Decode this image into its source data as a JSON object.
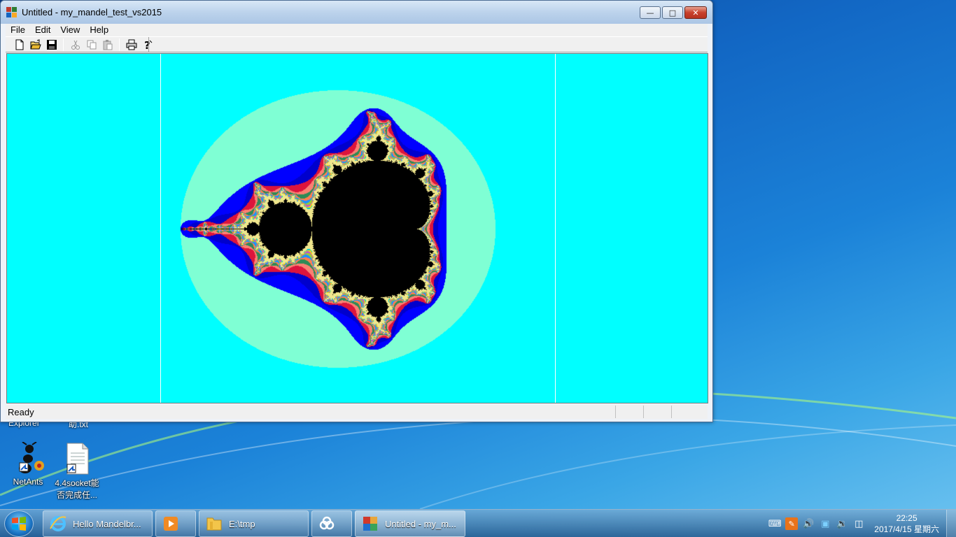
{
  "window": {
    "title": "Untitled - my_mandel_test_vs2015",
    "menu": [
      "File",
      "Edit",
      "View",
      "Help"
    ],
    "toolbar": [
      "new",
      "open",
      "save",
      "cut",
      "copy",
      "paste",
      "print",
      "help"
    ],
    "status": "Ready",
    "background_color": "#deb887"
  },
  "desktop": {
    "partial_labels": [
      "Explorer",
      "助.txt"
    ],
    "icons": [
      {
        "label": "NetAnts"
      },
      {
        "label_line1": "4.4socket能",
        "label_line2": "否完成任..."
      }
    ]
  },
  "taskbar": {
    "buttons": [
      {
        "label": "Hello Mandelbr..."
      },
      {
        "label": ""
      },
      {
        "label": "E:\\tmp"
      },
      {
        "label": ""
      },
      {
        "label": "Untitled - my_m..."
      }
    ],
    "clock_time": "22:25",
    "clock_date": "2017/4/15 星期六"
  }
}
